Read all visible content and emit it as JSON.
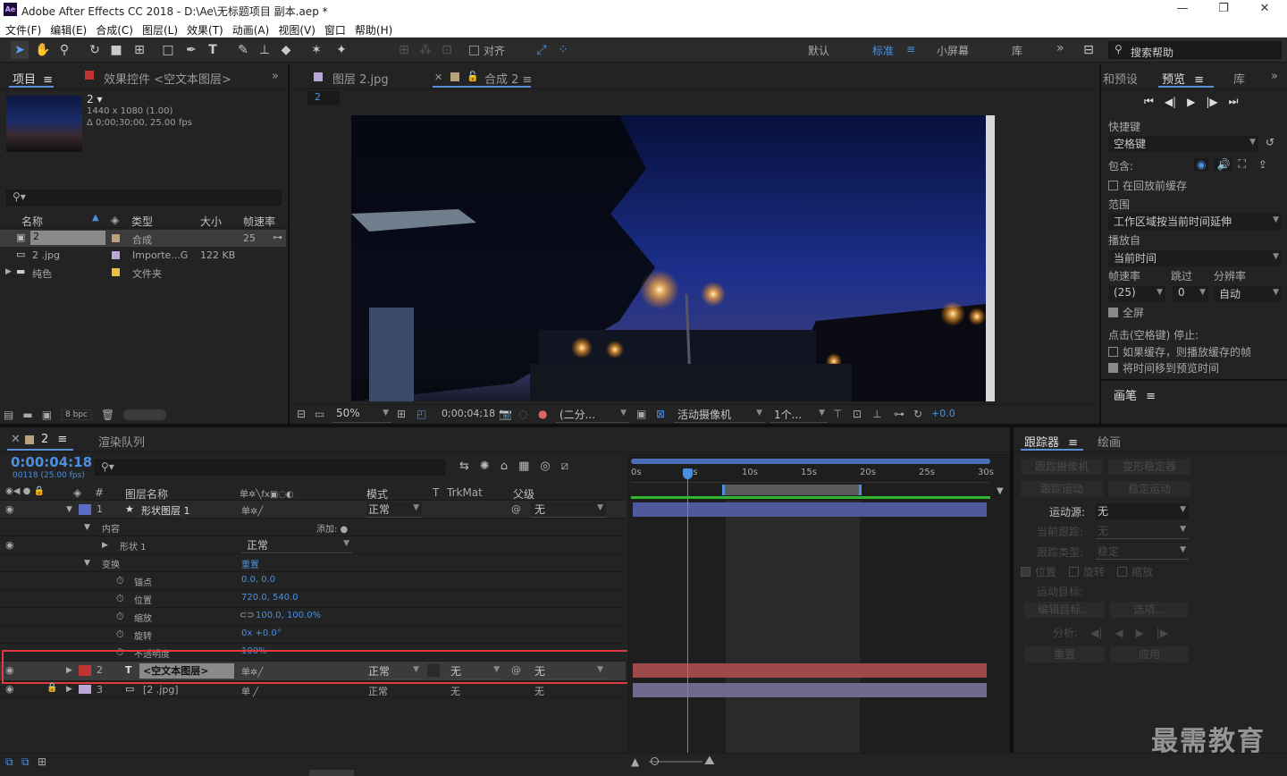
{
  "window": {
    "title": "Adobe After Effects CC 2018 - D:\\Ae\\无标题项目 副本.aep *",
    "logo": "Ae",
    "min": "—",
    "max": "❐",
    "close": "✕"
  },
  "menu": [
    "文件(F)",
    "编辑(E)",
    "合成(C)",
    "图层(L)",
    "效果(T)",
    "动画(A)",
    "视图(V)",
    "窗口",
    "帮助(H)"
  ],
  "toolbar": {
    "snap_label": "对齐",
    "workspaces": [
      "默认",
      "标准",
      "小屏幕",
      "库"
    ],
    "more": "»",
    "search_placeholder": "搜索帮助"
  },
  "project": {
    "tab_label": "项目",
    "effects_tab": "效果控件 <空文本图层>",
    "comp_name": "2",
    "comp_info1": "1440 x 1080 (1.00)",
    "comp_info2": "Δ 0;00;30;00, 25.00 fps",
    "columns": [
      "名称",
      "类型",
      "大小",
      "帧速率"
    ],
    "items": [
      {
        "name": "2",
        "type": "合成",
        "size": "",
        "fps": "25",
        "color": "#b8a27a"
      },
      {
        "name": "2 .jpg",
        "type": "Importe...G",
        "size": "122 KB",
        "fps": "",
        "color": "#b9a8d6"
      },
      {
        "name": "纯色",
        "type": "文件夹",
        "size": "",
        "fps": "",
        "color": "#e8c33a"
      }
    ],
    "bpc": "8 bpc"
  },
  "viewer": {
    "tab1": "图层 2.jpg",
    "tab2": "合成 2",
    "breadcrumb": "2",
    "zoom": "50%",
    "timecode": "0;00;04;18",
    "resolution": "(二分...",
    "camera": "活动摄像机",
    "views": "1个...",
    "exposure": "+0.0"
  },
  "preview": {
    "tab_presets": "和预设",
    "tab_preview": "预览",
    "tab_lib": "库",
    "shortcut_label": "快捷键",
    "shortcut_value": "空格键",
    "include_label": "包含:",
    "cache_before": "在回放前缓存",
    "range_label": "范围",
    "range_value": "工作区域按当前时间延伸",
    "play_from_label": "播放自",
    "play_from_value": "当前时间",
    "fps_label": "帧速率",
    "skip_label": "跳过",
    "res_label": "分辨率",
    "fps_value": "(25)",
    "skip_value": "0",
    "res_value": "自动",
    "fullscreen": "全屏",
    "stop_label": "点击(空格键) 停止:",
    "opt1": "如果缓存，则播放缓存的帧",
    "opt2": "将时间移到预览时间",
    "brush_tab": "画笔"
  },
  "timeline": {
    "comp_tab": "2",
    "render_queue": "渲染队列",
    "timecode": "0:00:04:18",
    "frames": "00118 (25.00 fps)",
    "col_layer_name": "图层名称",
    "col_mode": "模式",
    "col_t": "T",
    "col_trkmat": "TrkMat",
    "col_parent": "父级",
    "col_num": "#",
    "ruler": [
      "0s",
      "5s",
      "10s",
      "15s",
      "20s",
      "25s",
      "30s"
    ],
    "layers": [
      {
        "num": "1",
        "name": "形状图层 1",
        "mode": "正常",
        "trk": "",
        "parent": "无",
        "color": "#5b6ec4"
      },
      {
        "num": "2",
        "name": "<空文本图层>",
        "mode": "正常",
        "trk": "无",
        "parent": "无",
        "color": "#c03434"
      },
      {
        "num": "3",
        "name": "[2 .jpg]",
        "mode": "正常",
        "trk": "无",
        "parent": "无",
        "color": "#b9a8d6"
      }
    ],
    "contents_label": "内容",
    "add_label": "添加:",
    "shape_label": "形状 1",
    "shape_mode": "正常",
    "transform_label": "变换",
    "reset_label": "重置",
    "props": [
      {
        "name": "锚点",
        "value": "0.0, 0.0"
      },
      {
        "name": "位置",
        "value": "720.0, 540.0"
      },
      {
        "name": "缩放",
        "value": "100.0, 100.0%"
      },
      {
        "name": "旋转",
        "value": "0x +0.0°"
      },
      {
        "name": "不透明度",
        "value": "100%"
      }
    ]
  },
  "tracker": {
    "tab": "跟踪器",
    "tab2": "绘画",
    "btn_track_camera": "跟踪摄像机",
    "btn_warp": "变形稳定器",
    "btn_track_motion": "跟踪运动",
    "btn_stabilize": "稳定运动",
    "source_label": "运动源:",
    "source_value": "无",
    "current_label": "当前跟踪:",
    "current_value": "无",
    "type_label": "跟踪类型:",
    "type_value": "稳定",
    "pos": "位置",
    "rot": "旋转",
    "scale": "缩放",
    "target_label": "运动目标:",
    "edit_target": "编辑目标...",
    "options": "选项...",
    "analyze": "分析:",
    "reset": "重置",
    "apply": "应用"
  },
  "watermark": "最需教育"
}
